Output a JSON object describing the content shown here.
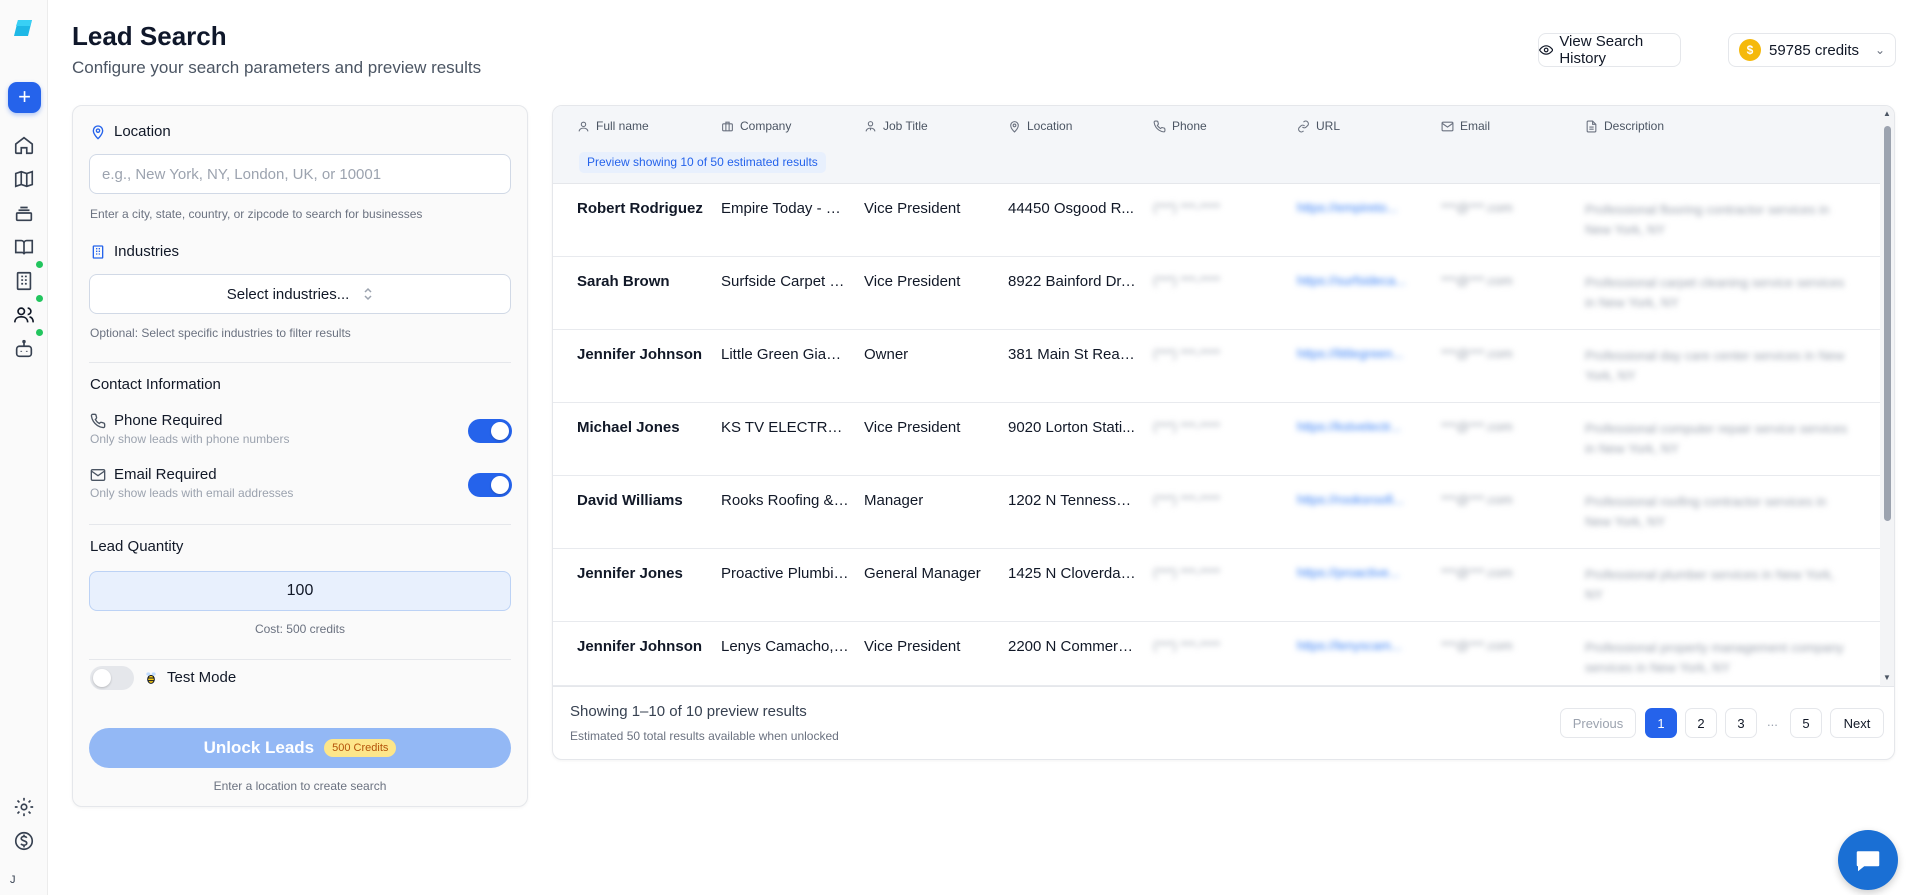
{
  "header": {
    "title": "Lead Search",
    "subtitle": "Configure your search parameters and preview results",
    "history_label": "View Search History",
    "credits_label": "59785 credits"
  },
  "sidebar": {
    "user_initial": "J",
    "items": [
      "home-icon",
      "map-icon",
      "layers-icon",
      "book-icon",
      "building-icon",
      "users-icon",
      "bot-icon"
    ]
  },
  "form": {
    "location": {
      "label": "Location",
      "placeholder": "e.g., New York, NY, London, UK, or 10001",
      "help": "Enter a city, state, country, or zipcode to search for businesses"
    },
    "industries": {
      "label": "Industries",
      "select_label": "Select industries...",
      "help": "Optional: Select specific industries to filter results"
    },
    "contact": {
      "heading": "Contact Information",
      "phone_title": "Phone Required",
      "phone_sub": "Only show leads with phone numbers",
      "phone_on": true,
      "email_title": "Email Required",
      "email_sub": "Only show leads with email addresses",
      "email_on": true
    },
    "quantity": {
      "label": "Lead Quantity",
      "value": "100",
      "cost": "Cost: 500 credits"
    },
    "test_mode": {
      "label": "Test Mode",
      "on": false
    },
    "unlock": {
      "label": "Unlock Leads",
      "badge": "500 Credits",
      "hint": "Enter a location to create search"
    }
  },
  "table": {
    "columns": [
      "Full name",
      "Company",
      "Job Title",
      "Location",
      "Phone",
      "URL",
      "Email",
      "Description"
    ],
    "preview_badge": "Preview showing 10 of 50 estimated results",
    "rows": [
      {
        "name": "Robert Rodriguez",
        "company": "Empire Today - Sa...",
        "title": "Vice President",
        "location": "44450 Osgood R...",
        "phone": "(***) ***-****",
        "url": "https://empireto...",
        "email": "***@***.com",
        "desc": "Professional flooring contractor services in New York, NY"
      },
      {
        "name": "Sarah Brown",
        "company": "Surfside Carpet Cl...",
        "title": "Vice President",
        "location": "8922 Bainford Dr, ...",
        "phone": "(***) ***-****",
        "url": "https://surfsideca...",
        "email": "***@***.com",
        "desc": "Professional carpet cleaning service services in New York, NY"
      },
      {
        "name": "Jennifer Johnson",
        "company": "Little Green Giant...",
        "title": "Owner",
        "location": "381 Main St Rear, L...",
        "phone": "(***) ***-****",
        "url": "https://littlegreen...",
        "email": "***@***.com",
        "desc": "Professional day care center services in New York, NY"
      },
      {
        "name": "Michael Jones",
        "company": "KS TV ELECTRONI...",
        "title": "Vice President",
        "location": "9020 Lorton Stati...",
        "phone": "(***) ***-****",
        "url": "https://kstvelectr...",
        "email": "***@***.com",
        "desc": "Professional computer repair service services in New York, NY"
      },
      {
        "name": "David Williams",
        "company": "Rooks Roofing & E...",
        "title": "Manager",
        "location": "1202 N Tennessee ...",
        "phone": "(***) ***-****",
        "url": "https://rooksroofi...",
        "email": "***@***.com",
        "desc": "Professional roofing contractor services in New York, NY"
      },
      {
        "name": "Jennifer Jones",
        "company": "Proactive Plumbin...",
        "title": "General Manager",
        "location": "1425 N Cloverdale ...",
        "phone": "(***) ***-****",
        "url": "https://proactive...",
        "email": "***@***.com",
        "desc": "Professional plumber services in New York, NY"
      },
      {
        "name": "Jennifer Johnson",
        "company": "Lenys Camacho, ...",
        "title": "Vice President",
        "location": "2200 N Commerc...",
        "phone": "(***) ***-****",
        "url": "https://lenyscam...",
        "email": "***@***.com",
        "desc": "Professional property management company services in New York, NY"
      }
    ],
    "footer_info": "Showing 1–10 of 10 preview results",
    "footer_sub": "Estimated 50 total results available when unlocked",
    "pagination": {
      "previous": "Previous",
      "pages": [
        "1",
        "2",
        "3",
        "5"
      ],
      "ellipsis": "...",
      "current": "1",
      "next": "Next"
    }
  },
  "colors": {
    "accent": "#2563eb",
    "online_dot": "#22c55e",
    "coin": "#f5b90b",
    "chat": "#1a6fd4"
  }
}
